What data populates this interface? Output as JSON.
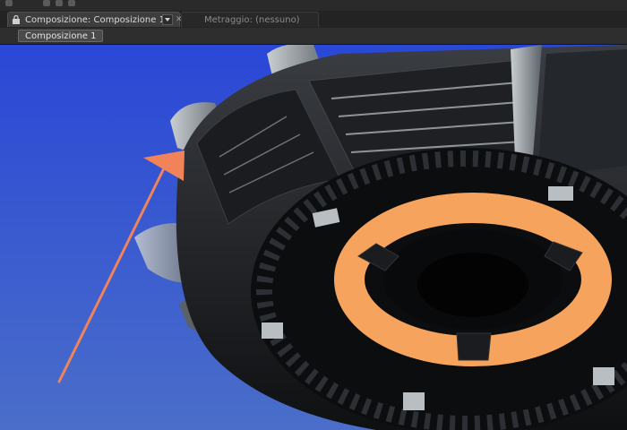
{
  "tabs": [
    {
      "label": "Composizione: Composizione 1",
      "active": true
    },
    {
      "label": "Metraggio: (nessuno)",
      "active": false
    }
  ],
  "breadcrumb": {
    "label": "Composizione 1"
  },
  "icons": {
    "lock": "lock-icon",
    "dropdown": "chevron-down-icon",
    "close": "close-icon",
    "annotation": "arrow-annotation"
  },
  "colors": {
    "canvas_top": "#2a47d6",
    "canvas_bottom": "#4a6ec9",
    "accent_ring": "#f5a35d",
    "arrow": "#f0835a"
  }
}
